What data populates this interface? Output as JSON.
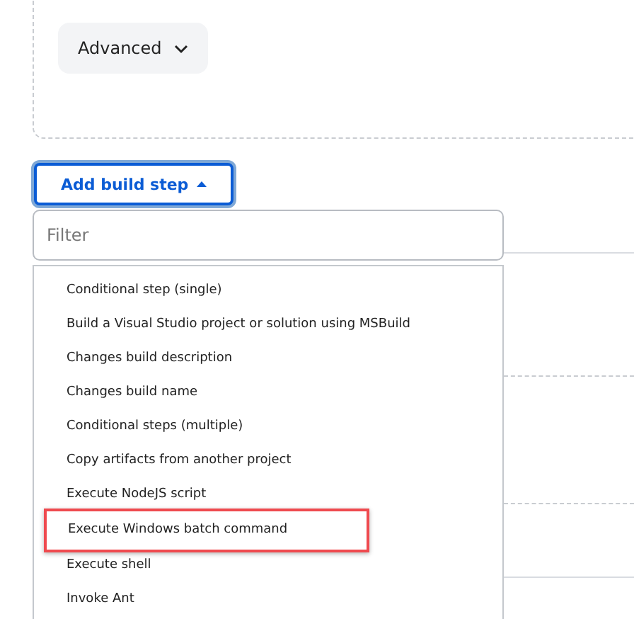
{
  "advanced_button": {
    "label": "Advanced"
  },
  "add_build_step_button": {
    "label": "Add build step",
    "expanded": true
  },
  "filter_field": {
    "placeholder": "Filter"
  },
  "menu_items": [
    {
      "label": "Conditional step (single)",
      "highlighted": false
    },
    {
      "label": "Build a Visual Studio project or solution using MSBuild",
      "highlighted": false
    },
    {
      "label": "Changes build description",
      "highlighted": false
    },
    {
      "label": "Changes build name",
      "highlighted": false
    },
    {
      "label": "Conditional steps (multiple)",
      "highlighted": false
    },
    {
      "label": "Copy artifacts from another project",
      "highlighted": false
    },
    {
      "label": "Execute NodeJS script",
      "highlighted": false
    },
    {
      "label": "Execute Windows batch command",
      "highlighted": true
    },
    {
      "label": "Execute shell",
      "highlighted": false
    },
    {
      "label": "Invoke Ant",
      "highlighted": false
    }
  ]
}
